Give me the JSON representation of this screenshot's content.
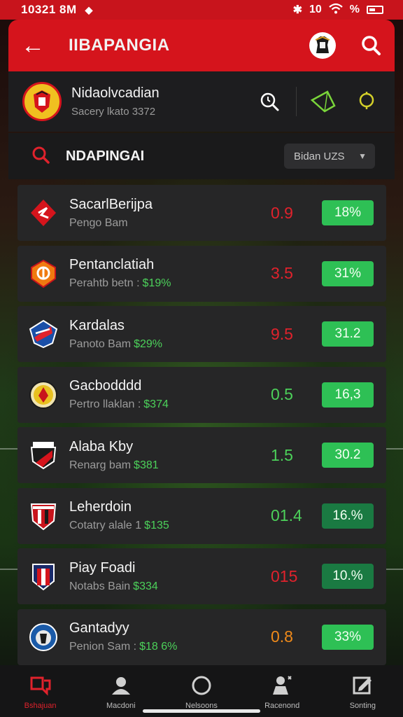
{
  "status_bar": {
    "time": "10321 8M",
    "signal_text": "10",
    "percent": "%"
  },
  "header": {
    "title": "IIBAPANGIA"
  },
  "profile": {
    "name": "Nidaolvcadian",
    "subtitle": "Sacery lkato 3372"
  },
  "search": {
    "label": "NDAPINGAI",
    "sort_value": "Bidan UZS"
  },
  "rows": [
    {
      "name": "SacarlBerijpa",
      "meta": "Pengo Bam",
      "amount": "",
      "odds": "0.9",
      "odds_color": "red",
      "pct": "18%",
      "pct_style": "bright",
      "logo": "red-diamond-icon"
    },
    {
      "name": "Pentanclatiah",
      "meta": "Perahtb betn :",
      "amount": "$19%",
      "odds": "3.5",
      "odds_color": "red",
      "pct": "31%",
      "pct_style": "bright",
      "logo": "orange-shield-icon"
    },
    {
      "name": "Kardalas",
      "meta": "Panoto Bam",
      "amount": "$29%",
      "odds": "9.5",
      "odds_color": "red",
      "pct": "31.2",
      "pct_style": "bright",
      "logo": "blue-shield-icon"
    },
    {
      "name": "Gacbodddd",
      "meta": "Pertro llaklan :",
      "amount": "$374",
      "odds": "0.5",
      "odds_color": "green",
      "pct": "16,3",
      "pct_style": "bright",
      "logo": "yellow-crest-icon"
    },
    {
      "name": "Alaba Kby",
      "meta": "Renarg bam",
      "amount": "$381",
      "odds": "1.5",
      "odds_color": "green",
      "pct": "30.2",
      "pct_style": "bright",
      "logo": "black-red-shield-icon"
    },
    {
      "name": "Leherdoin",
      "meta": "Cotatry alale 1",
      "amount": "$135",
      "odds": "01.4",
      "odds_color": "green",
      "pct": "16.%",
      "pct_style": "dark",
      "logo": "striped-shield-icon"
    },
    {
      "name": "Piay Foadi",
      "meta": "Notabs Bain",
      "amount": "$334",
      "odds": "015",
      "odds_color": "red",
      "pct": "10.%",
      "pct_style": "dark",
      "logo": "blue-red-shield-icon"
    },
    {
      "name": "Gantadyy",
      "meta": "Penion Sam :",
      "amount": "$18 6%",
      "odds": "0.8",
      "odds_color": "orange",
      "pct": "33%",
      "pct_style": "bright",
      "logo": "blue-badge-icon"
    }
  ],
  "bottom_nav": [
    {
      "label": "Bshajuan",
      "icon": "chat-icon",
      "active": true
    },
    {
      "label": "Macdoni",
      "icon": "user-icon",
      "active": false
    },
    {
      "label": "Nelsoons",
      "icon": "circle-icon",
      "active": false
    },
    {
      "label": "Racenond",
      "icon": "coach-icon",
      "active": false
    },
    {
      "label": "Sonting",
      "icon": "edit-icon",
      "active": false
    }
  ],
  "colors": {
    "brand_red": "#d5141c",
    "win_green": "#2ec055",
    "odds_red": "#e0222c",
    "odds_green": "#4cd15a"
  }
}
